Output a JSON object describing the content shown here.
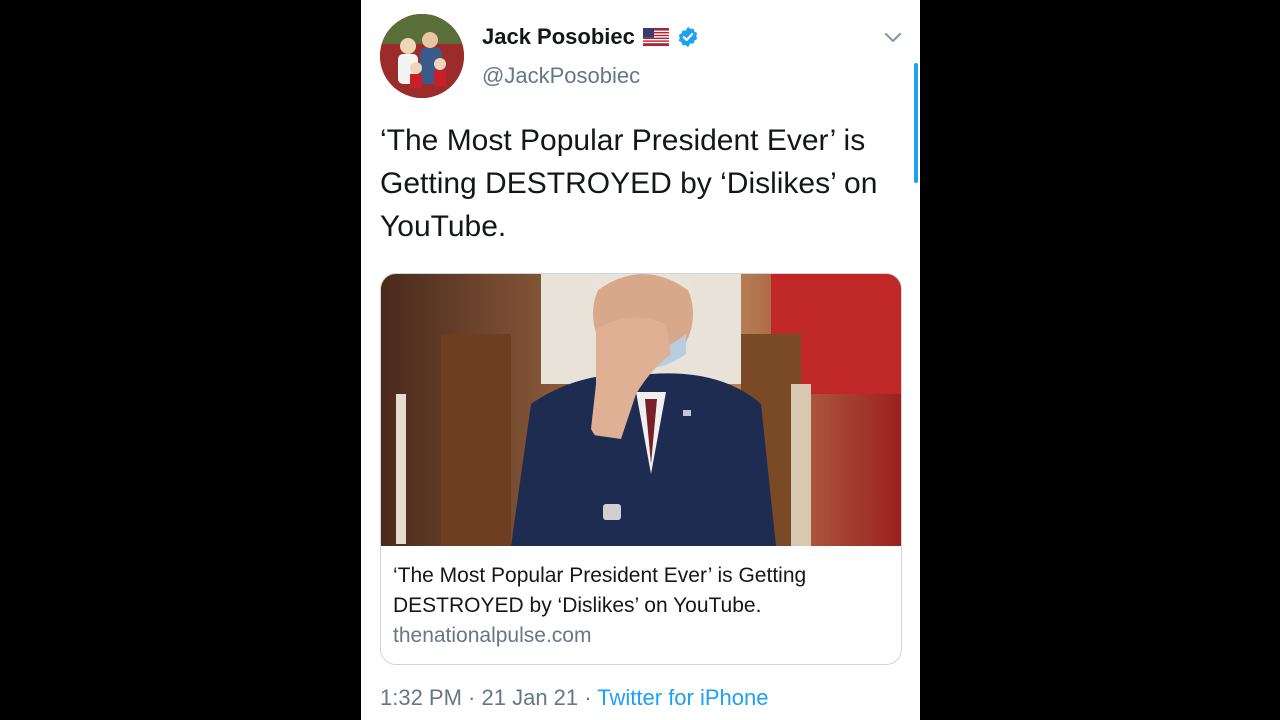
{
  "author": {
    "name": "Jack Posobiec",
    "handle": "@JackPosobiec",
    "flag_icon": "us-flag-icon",
    "verified_icon": "verified-badge-icon"
  },
  "tweet": {
    "text": "‘The Most Popular President Ever’ is Getting DESTROYED by ‘Dislikes’ on YouTube."
  },
  "card": {
    "title": "‘The Most Popular President Ever’ is Getting DESTROYED by ‘Dislikes’ on YouTube.",
    "domain": "thenationalpulse.com"
  },
  "meta": {
    "time": "1:32 PM",
    "separator": " · ",
    "date": "21 Jan 21",
    "source": "Twitter for iPhone"
  },
  "colors": {
    "accent": "#1da1f2",
    "text": "#14171a",
    "muted": "#657786",
    "border": "#ccd6dd"
  }
}
